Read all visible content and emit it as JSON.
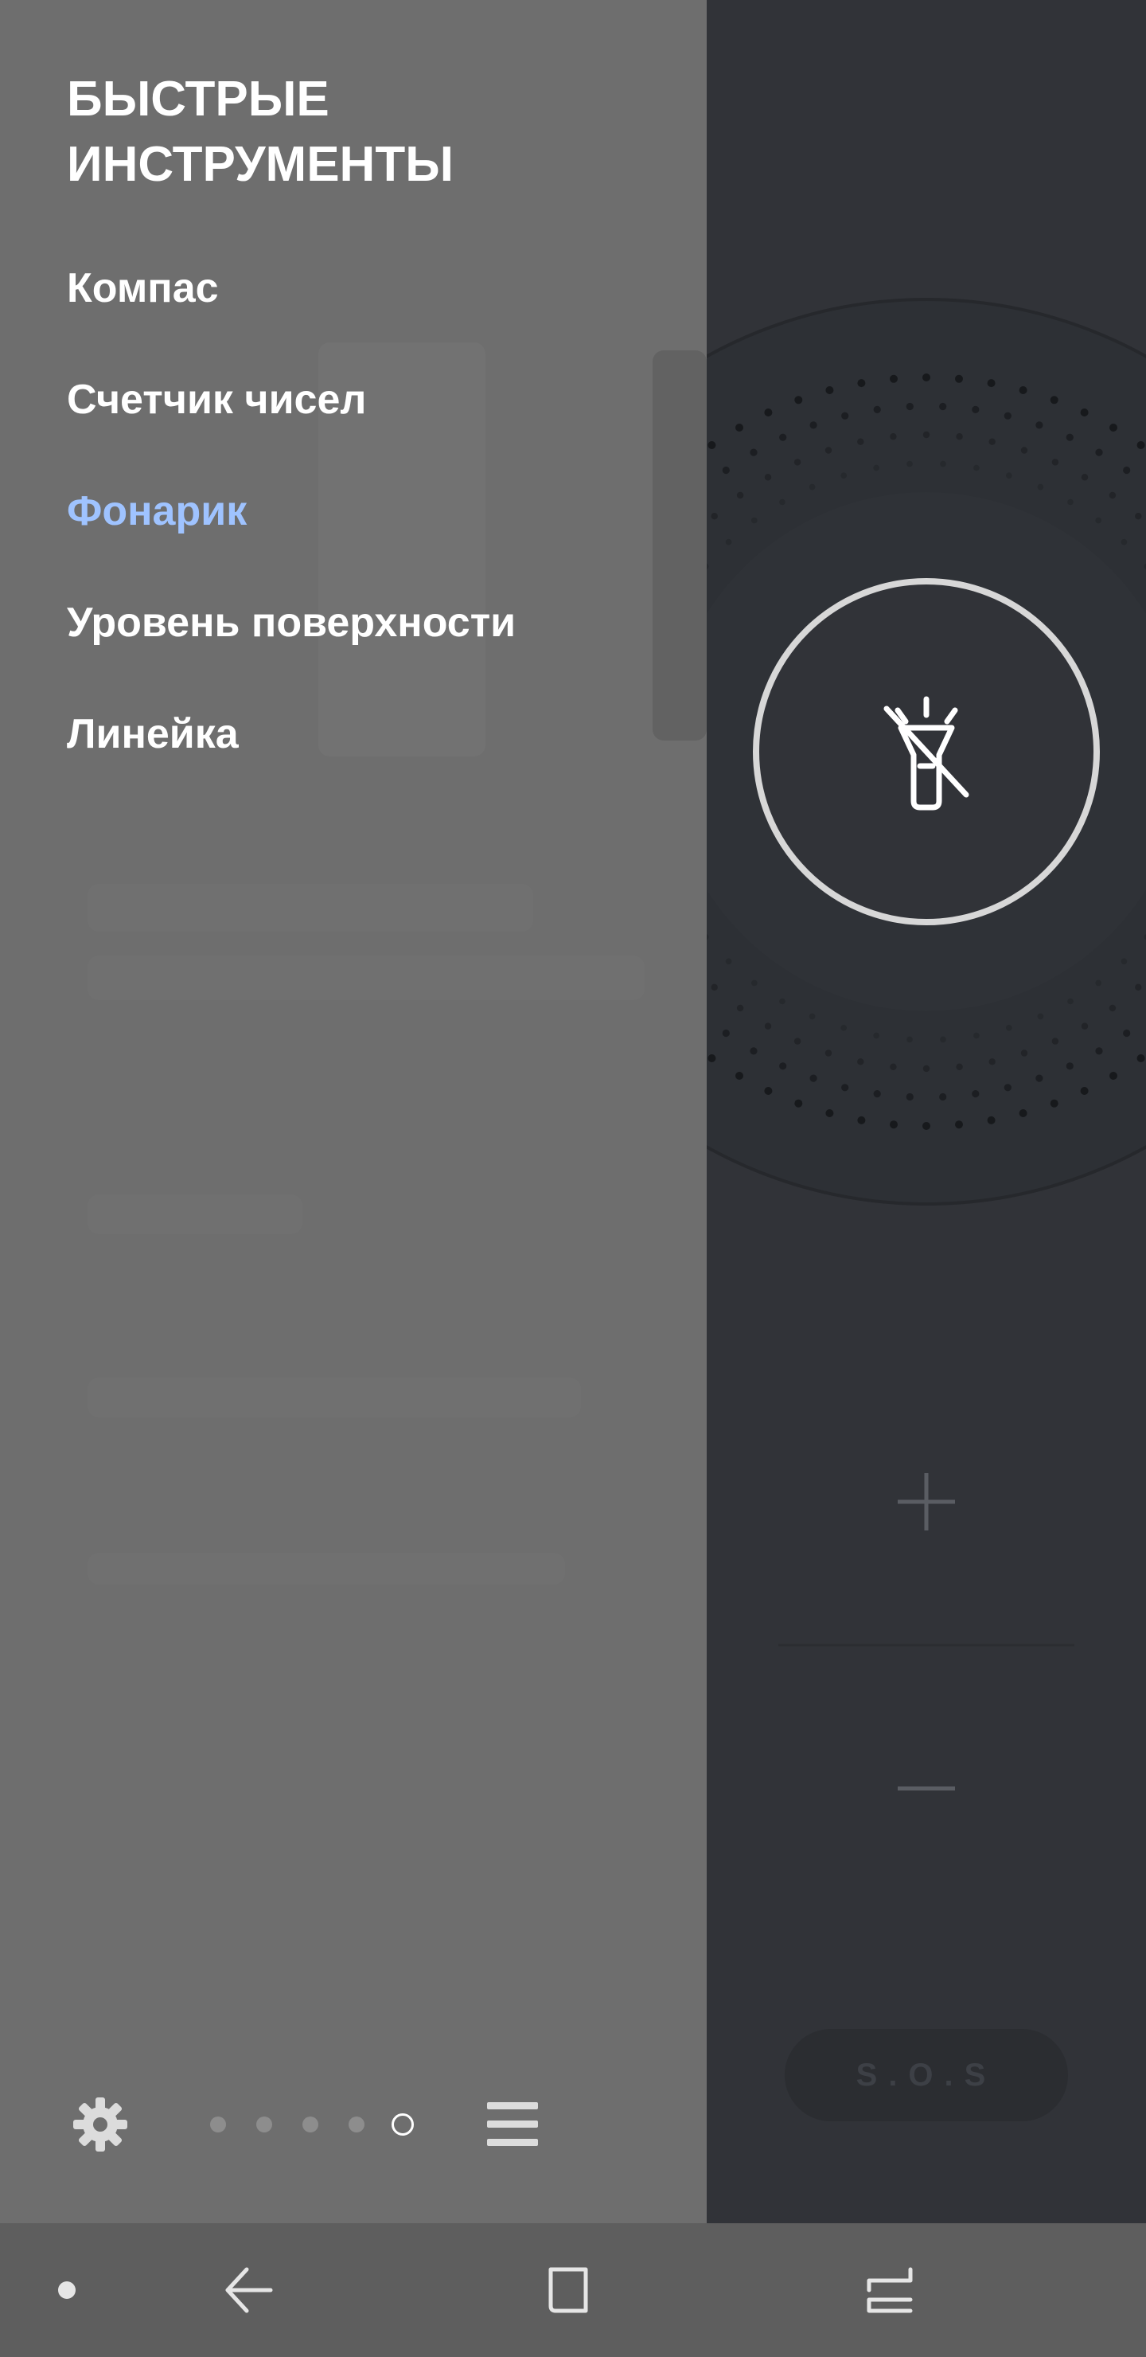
{
  "drawer": {
    "title": "БЫСТРЫЕ\nИНСТРУМЕНТЫ",
    "items": [
      {
        "label": "Компас",
        "active": false
      },
      {
        "label": "Счетчик чисел",
        "active": false
      },
      {
        "label": "Фонарик",
        "active": true
      },
      {
        "label": "Уровень поверхности",
        "active": false
      },
      {
        "label": "Линейка",
        "active": false
      }
    ],
    "active_color": "#9fc3ff",
    "page_indicator": {
      "total": 5,
      "current": 5
    }
  },
  "flashlight": {
    "power_icon": "flashlight-off-icon",
    "sos_label": "S.O.S"
  },
  "icons": {
    "settings": "gear-icon",
    "menu": "hamburger-icon",
    "increase": "plus-icon",
    "decrease": "minus-icon",
    "nav_dot": "dot-icon",
    "nav_back": "back-arrow-icon",
    "nav_home": "home-square-icon",
    "nav_recent": "recent-apps-icon"
  }
}
